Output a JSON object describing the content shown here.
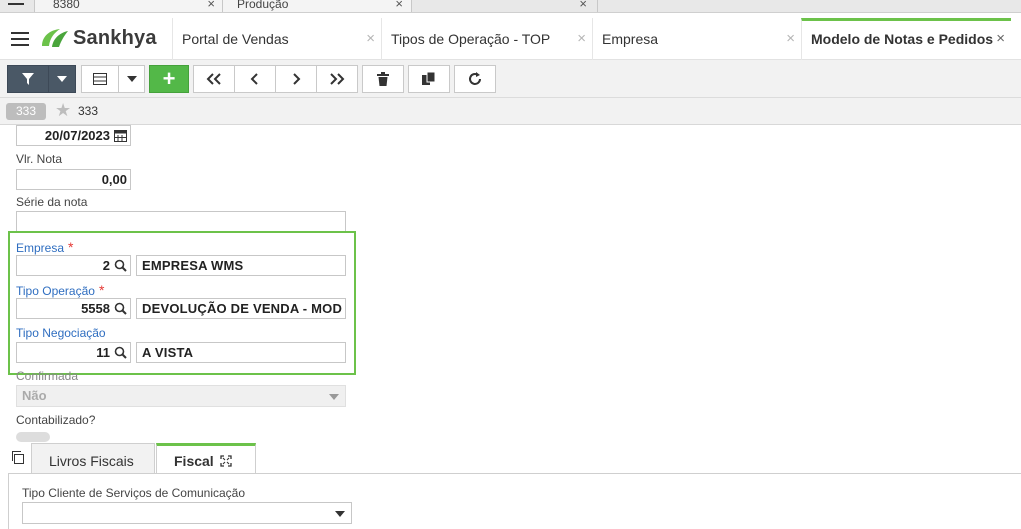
{
  "browser_tabs": [
    {
      "label": "8380"
    },
    {
      "label": "Produção"
    }
  ],
  "app": {
    "brand": "Sankhya",
    "brand_color": "#6cc24a"
  },
  "app_tabs": [
    {
      "label": "Portal de Vendas",
      "active": false
    },
    {
      "label": "Tipos de Operação - TOP",
      "active": false
    },
    {
      "label": "Empresa",
      "active": false
    },
    {
      "label": "Modelo de Notas e Pedidos",
      "active": true
    }
  ],
  "toolbar": {
    "icons": [
      "filter-icon",
      "dropdown-icon",
      "grid-icon",
      "dropdown-icon",
      "add-icon",
      "first-icon",
      "prev-icon",
      "next-icon",
      "last-icon",
      "trash-icon",
      "copy-icon",
      "refresh-icon"
    ],
    "add_label": "+"
  },
  "record": {
    "badge": "333",
    "title": "333"
  },
  "form": {
    "date_value": "20/07/2023",
    "vlr_nota": {
      "label": "Vlr. Nota",
      "value": "0,00"
    },
    "serie_nota": {
      "label": "Série da nota",
      "value": ""
    },
    "empresa": {
      "label": "Empresa",
      "required_mark": "*",
      "code": "2",
      "name": "EMPRESA WMS"
    },
    "tipo_operacao": {
      "label": "Tipo Operação",
      "required_mark": "*",
      "code": "5558",
      "name": "DEVOLUÇÃO DE VENDA - MOD (("
    },
    "tipo_negociacao": {
      "label": "Tipo Negociação",
      "code": "11",
      "name": "A VISTA"
    },
    "confirmada": {
      "label": "Confirmada",
      "value": "Não"
    },
    "contabilizado": {
      "label": "Contabilizado?"
    }
  },
  "lower_tabs": [
    {
      "label": "Livros Fiscais",
      "active": false
    },
    {
      "label": "Fiscal",
      "active": true
    }
  ],
  "fiscal_panel": {
    "tipo_cliente_label": "Tipo Cliente de Serviços de Comunicação",
    "tipo_cliente_value": ""
  }
}
